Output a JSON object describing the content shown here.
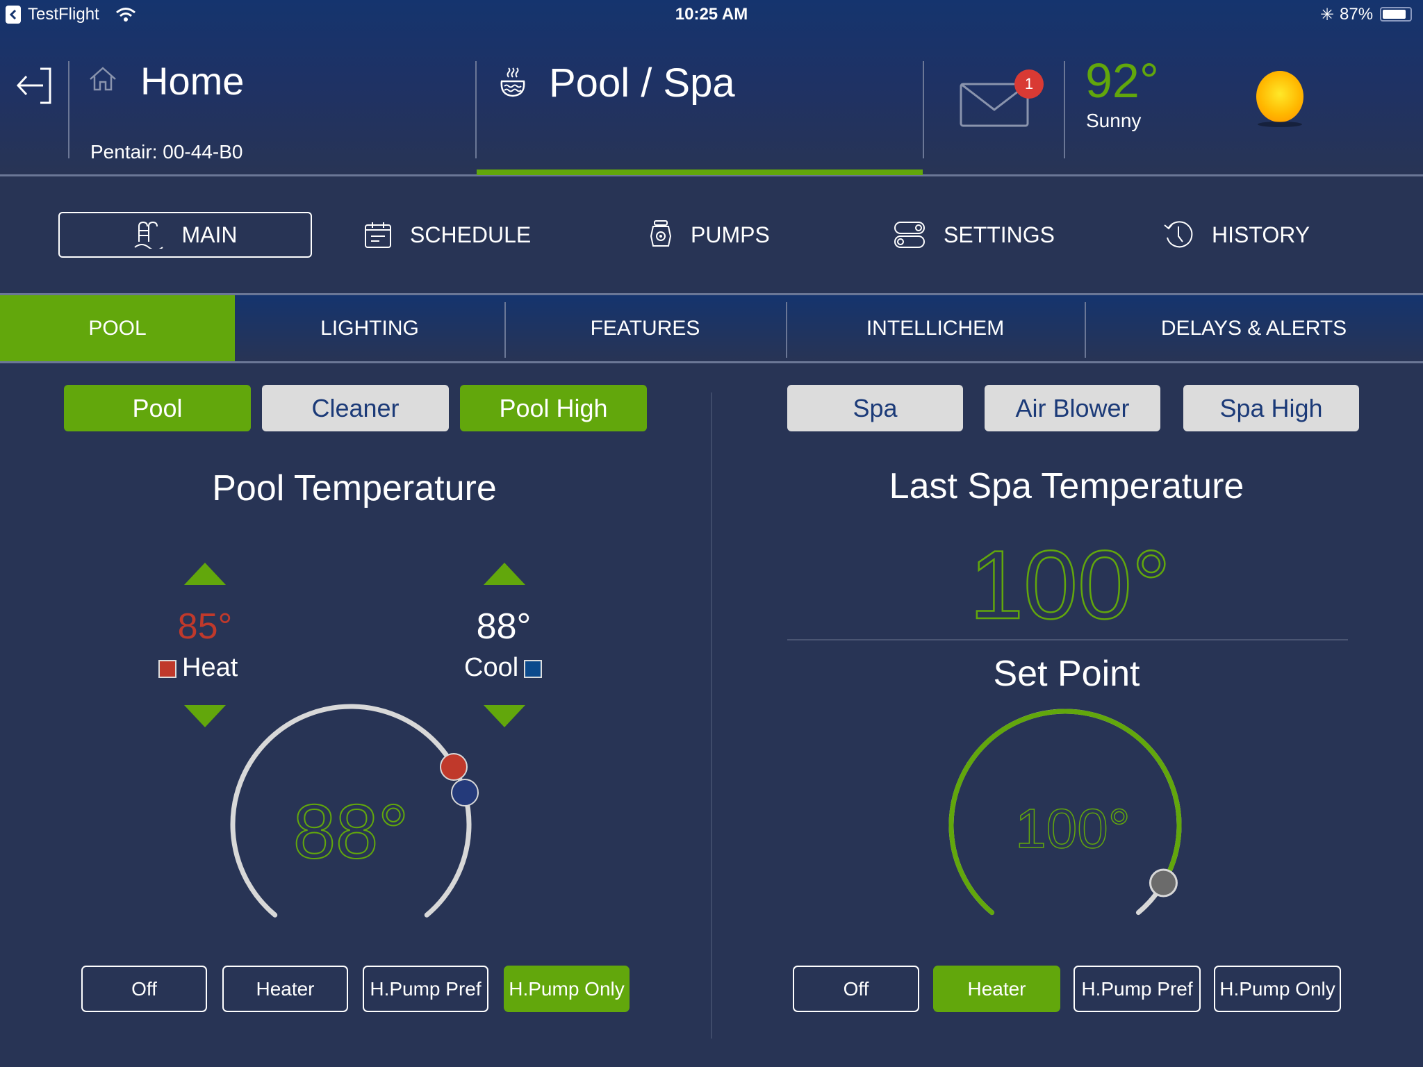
{
  "status_bar": {
    "back_app": "TestFlight",
    "time": "10:25 AM",
    "battery": "87%",
    "battery_level": 0.87
  },
  "header": {
    "home_title": "Home",
    "device_id": "Pentair: 00-44-B0",
    "section_title": "Pool / Spa",
    "messages_count": "1",
    "weather_temp": "92°",
    "weather_condition": "Sunny"
  },
  "nav": {
    "items": [
      {
        "label": "MAIN",
        "icon": "pool-ladder-icon",
        "active": true
      },
      {
        "label": "SCHEDULE",
        "icon": "calendar-icon",
        "active": false
      },
      {
        "label": "PUMPS",
        "icon": "pump-icon",
        "active": false
      },
      {
        "label": "SETTINGS",
        "icon": "toggles-icon",
        "active": false
      },
      {
        "label": "HISTORY",
        "icon": "history-icon",
        "active": false
      }
    ]
  },
  "tabs": [
    {
      "label": "POOL",
      "active": true
    },
    {
      "label": "LIGHTING",
      "active": false
    },
    {
      "label": "FEATURES",
      "active": false
    },
    {
      "label": "INTELLICHEM",
      "active": false
    },
    {
      "label": "DELAYS & ALERTS",
      "active": false
    }
  ],
  "pool": {
    "circuits": [
      {
        "label": "Pool",
        "on": true
      },
      {
        "label": "Cleaner",
        "on": false
      },
      {
        "label": "Pool High",
        "on": true
      }
    ],
    "title": "Pool Temperature",
    "heat_setpoint": "85°",
    "heat_label": "Heat",
    "cool_setpoint": "88°",
    "cool_label": "Cool",
    "current_temp": "88°",
    "heat_color": "#c0392b",
    "cool_color": "#0c4a8c",
    "modes": [
      {
        "label": "Off",
        "on": false
      },
      {
        "label": "Heater",
        "on": false
      },
      {
        "label": "H.Pump Pref",
        "on": false
      },
      {
        "label": "H.Pump Only",
        "on": true
      }
    ]
  },
  "spa": {
    "circuits": [
      {
        "label": "Spa",
        "on": false
      },
      {
        "label": "Air Blower",
        "on": false
      },
      {
        "label": "Spa High",
        "on": false
      }
    ],
    "title": "Last Spa Temperature",
    "last_temp": "100°",
    "setpoint_title": "Set Point",
    "setpoint": "100°",
    "setpoint_fraction": 1.0,
    "modes": [
      {
        "label": "Off",
        "on": false
      },
      {
        "label": "Heater",
        "on": true
      },
      {
        "label": "H.Pump Pref",
        "on": false
      },
      {
        "label": "H.Pump Only",
        "on": false
      }
    ]
  },
  "colors": {
    "accent_green": "#62a70c",
    "background": "#283455",
    "header_blue": "#15346e",
    "badge_red": "#d93a34"
  }
}
